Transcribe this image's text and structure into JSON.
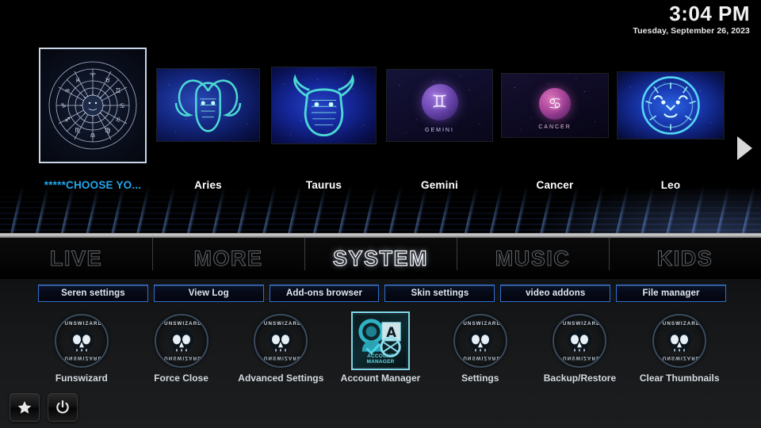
{
  "clock": {
    "time": "3:04 PM",
    "date": "Tuesday, September 26, 2023"
  },
  "carousel": {
    "next_arrow_icon": "chevron-right-icon",
    "items": [
      {
        "label": "*****CHOOSE YO...",
        "art": "zodiac-wheel",
        "selected": true
      },
      {
        "label": "Aries",
        "art": "aries-ram",
        "selected": false
      },
      {
        "label": "Taurus",
        "art": "taurus-bull",
        "selected": false
      },
      {
        "label": "Gemini",
        "art": "gemini-sphere",
        "glyph": "♊",
        "caption": "GEMINI",
        "selected": false
      },
      {
        "label": "Cancer",
        "art": "cancer-sphere",
        "glyph": "♋",
        "caption": "CANCER",
        "selected": false
      },
      {
        "label": "Leo",
        "art": "leo-lion",
        "selected": false
      }
    ]
  },
  "menu": {
    "items": [
      {
        "label": "LIVE",
        "active": false
      },
      {
        "label": "MORE",
        "active": false
      },
      {
        "label": "SYSTEM",
        "active": true
      },
      {
        "label": "MUSIC",
        "active": false
      },
      {
        "label": "KIDS",
        "active": false
      }
    ]
  },
  "system_buttons": [
    {
      "label": "Seren settings"
    },
    {
      "label": "View Log"
    },
    {
      "label": "Add-ons browser"
    },
    {
      "label": "Skin settings"
    },
    {
      "label": "video addons"
    },
    {
      "label": "File manager"
    }
  ],
  "shortcuts": [
    {
      "label": "Funswizard",
      "icon": "funswizard-skull-icon",
      "emblem_text": "FUNSWIZARD",
      "highlight": false
    },
    {
      "label": "Force Close",
      "icon": "funswizard-skull-icon",
      "emblem_text": "FUNSWIZARD",
      "highlight": false
    },
    {
      "label": "Advanced Settings",
      "icon": "funswizard-skull-icon",
      "emblem_text": "FUNSWIZARD",
      "highlight": false
    },
    {
      "label": "Account Manager",
      "icon": "account-manager-icon",
      "emblem_text": "ACCOUNT MANAGER",
      "highlight": true
    },
    {
      "label": "Settings",
      "icon": "funswizard-skull-icon",
      "emblem_text": "FUNSWIZARD",
      "highlight": false
    },
    {
      "label": "Backup/Restore",
      "icon": "funswizard-skull-icon",
      "emblem_text": "FUNSWIZARD",
      "highlight": false
    },
    {
      "label": "Clear Thumbnails",
      "icon": "funswizard-skull-icon",
      "emblem_text": "FUNSWIZARD",
      "highlight": false
    }
  ],
  "corner_buttons": [
    {
      "name": "favourites-button",
      "icon": "star-icon"
    },
    {
      "name": "power-button",
      "icon": "power-icon"
    }
  ],
  "colors": {
    "accent_blue": "#22a7f0",
    "button_border": "#2f6fd0",
    "panel_bg": "#17191b",
    "highlight": "#7fd8e8"
  }
}
